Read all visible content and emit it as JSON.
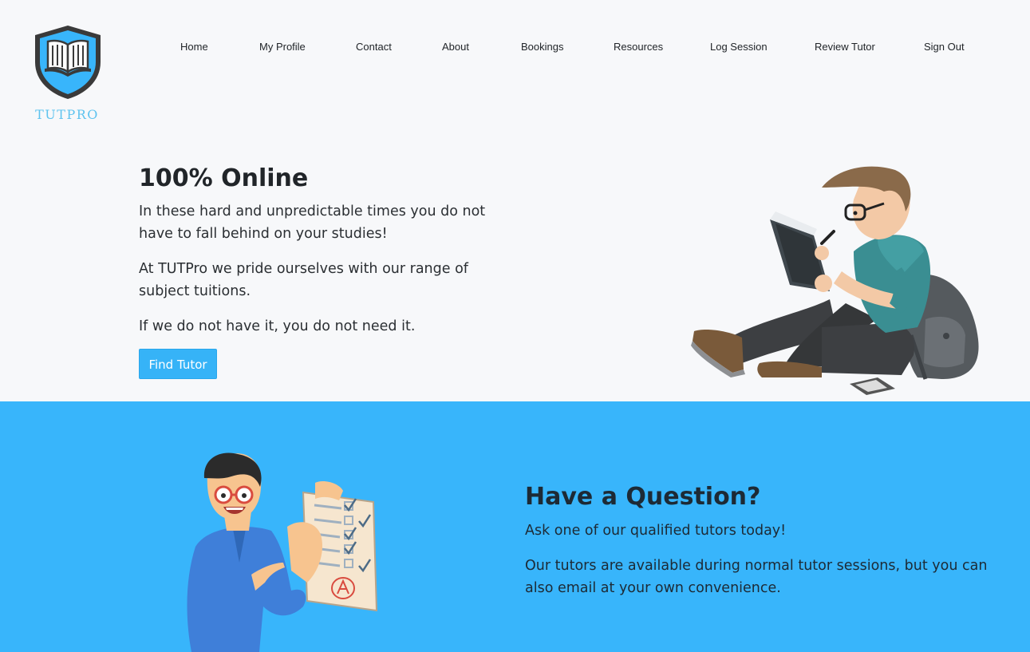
{
  "brand": {
    "name": "TUTPRO",
    "accent": "#38b5fb"
  },
  "nav": {
    "items": [
      "Home",
      "My Profile",
      "Contact",
      "About",
      "Bookings",
      "Resources",
      "Log Session",
      "Review Tutor",
      "Sign Out"
    ]
  },
  "hero": {
    "title": "100% Online",
    "paragraphs": [
      "In these hard and unpredictable times you do not have to fall behind on your studies!",
      "At TUTPro we pride ourselves with our range of subject tuitions.",
      "If we do not have it, you do not need it."
    ],
    "button_label": "Find Tutor",
    "illustration": "student-reading-icon"
  },
  "question": {
    "title": "Have a Question?",
    "paragraphs": [
      "Ask one of our qualified tutors today!",
      "Our tutors are available during normal tutor sessions, but you can also email at your own convenience."
    ],
    "illustration": "tutor-checklist-icon"
  }
}
